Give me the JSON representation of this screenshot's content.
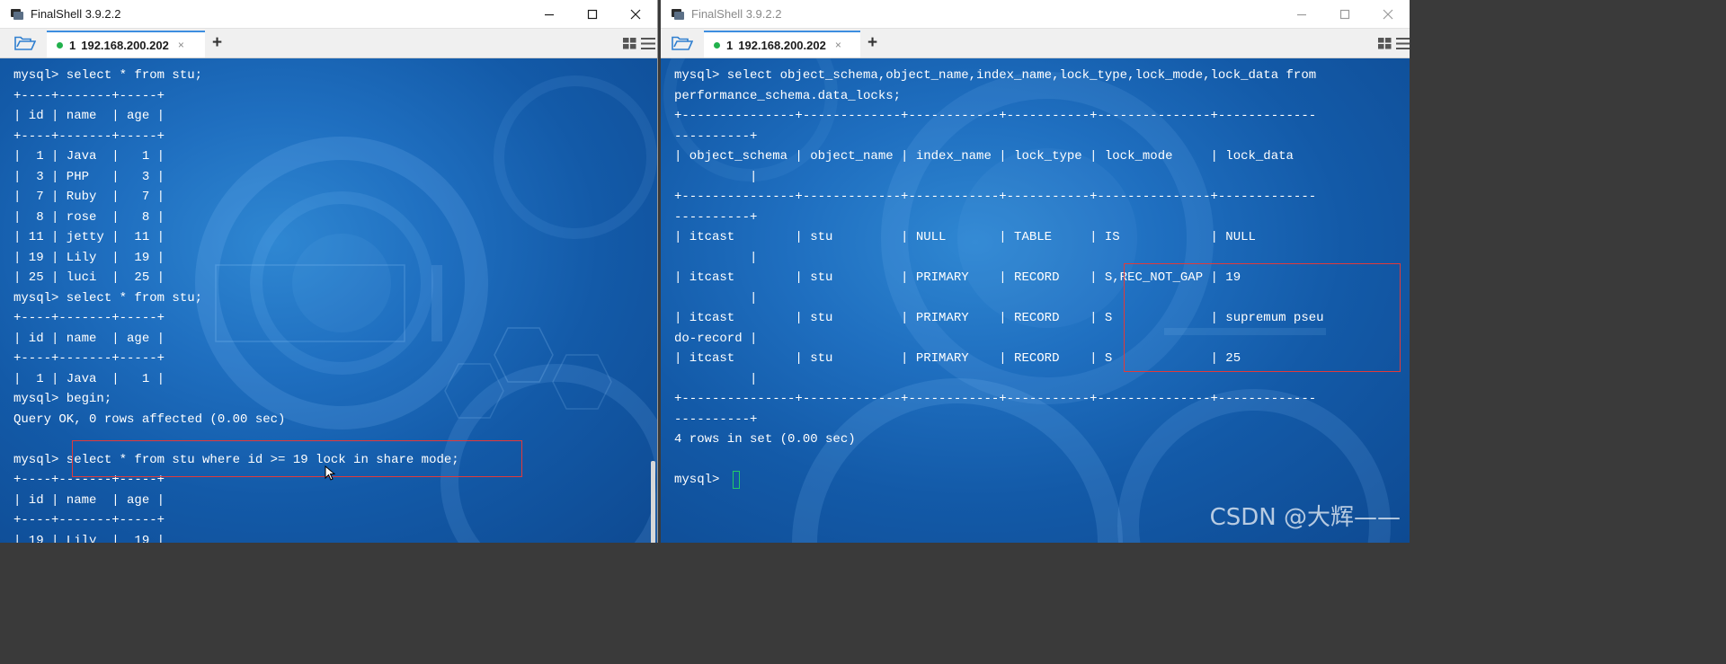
{
  "windows": [
    {
      "title": "FinalShell 3.9.2.2",
      "tab_number": "1",
      "tab_host": "192.168.200.202",
      "tab_close": "×",
      "add_tab": "+",
      "terminal_lines": [
        "mysql> select * from stu;",
        "+----+-------+-----+",
        "| id | name  | age |",
        "+----+-------+-----+",
        "|  1 | Java  |   1 |",
        "|  3 | PHP   |   3 |",
        "|  7 | Ruby  |   7 |",
        "|  8 | rose  |   8 |",
        "| 11 | jetty |  11 |",
        "| 19 | Lily  |  19 |",
        "| 25 | luci  |  25 |",
        "mysql> select * from stu;",
        "+----+-------+-----+",
        "| id | name  | age |",
        "+----+-------+-----+",
        "|  1 | Java  |   1 |",
        "mysql> begin;",
        "Query OK, 0 rows affected (0.00 sec)",
        "",
        "mysql> select * from stu where id >= 19 lock in share mode;",
        "+----+-------+-----+",
        "| id | name  | age |",
        "+----+-------+-----+",
        "| 19 | Lily  |  19 |"
      ]
    },
    {
      "title": "FinalShell 3.9.2.2",
      "tab_number": "1",
      "tab_host": "192.168.200.202",
      "tab_close": "×",
      "add_tab": "+",
      "terminal_lines": [
        "mysql> select object_schema,object_name,index_name,lock_type,lock_mode,lock_data from",
        "performance_schema.data_locks;",
        "+---------------+-------------+------------+-----------+---------------+-------------",
        "----------+",
        "| object_schema | object_name | index_name | lock_type | lock_mode     | lock_data",
        "          |",
        "+---------------+-------------+------------+-----------+---------------+-------------",
        "----------+",
        "| itcast        | stu         | NULL       | TABLE     | IS            | NULL",
        "          |",
        "| itcast        | stu         | PRIMARY    | RECORD    | S,REC_NOT_GAP | 19",
        "          |",
        "| itcast        | stu         | PRIMARY    | RECORD    | S             | supremum pseu",
        "do-record |",
        "| itcast        | stu         | PRIMARY    | RECORD    | S             | 25",
        "          |",
        "+---------------+-------------+------------+-----------+---------------+-------------",
        "----------+",
        "4 rows in set (0.00 sec)",
        "",
        "mysql> "
      ]
    }
  ],
  "watermark": "CSDN @大辉——",
  "colors": {
    "terminal_text": "#ffffff",
    "highlight_box": "#e23a3a",
    "tab_accent": "#3d8ee0",
    "tab_status_dot": "#22b14c",
    "cursor": "#22cc66"
  }
}
